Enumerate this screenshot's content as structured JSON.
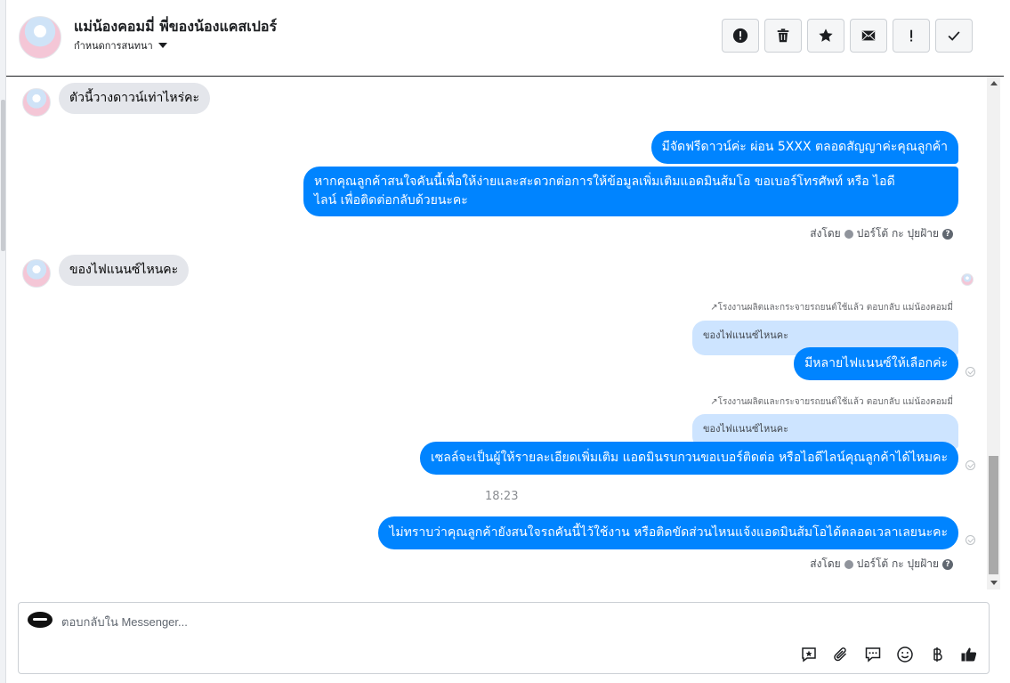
{
  "header": {
    "title": "แม่น้องคอมมี่ พี่ของน้องแคสเปอร์",
    "subtitle": "กำหนดการสนทนา",
    "actions": [
      {
        "name": "report-spam-button",
        "icon": "exclamation-circle-icon"
      },
      {
        "name": "delete-button",
        "icon": "trash-icon"
      },
      {
        "name": "star-button",
        "icon": "star-icon"
      },
      {
        "name": "mark-unread-button",
        "icon": "envelope-icon"
      },
      {
        "name": "flag-button",
        "icon": "exclamation-icon"
      },
      {
        "name": "mark-done-button",
        "icon": "checkmark-icon"
      }
    ]
  },
  "messages": {
    "in_1": "ตัวนี้วางดาวน์เท่าไหร่คะ",
    "out_1": "มีจัดฟรีดาวน์ค่ะ ผ่อน 5XXX ตลอดสัญญาค่ะคุณลูกค้า",
    "out_2_line1": "หากคุณลูกค้าสนใจคันนี้เพื่อให้ง่ายและสะดวกต่อการให้ข้อมูลเพิ่มเติมแอดมินส้มโอ ขอเบอร์โทรศัพท์ หรือ ไอดี",
    "out_2_line2": "ไลน์ เพื่อติดต่อกลับด้วยนะคะ",
    "sent_by_label": "ส่งโดย",
    "sent_by_name": "ปอร์โต้ กะ ปุยฝ้าย",
    "in_2": "ของไฟแนนซ์ไหนคะ",
    "reply_note": "โรงงานผลิตและกระจายรถยนต์ใช้แล้ว ตอบกลับ แม่น้องคอมมี่",
    "quoted": "ของไฟแนนซ์ไหนคะ",
    "out_3": "มีหลายไฟแนนซ์ให้เลือกค่ะ",
    "out_4": "เซลล์จะเป็นผู้ให้รายละเอียดเพิ่มเติม แอดมินรบกวนขอเบอร์ติดต่อ หรือไอดีไลน์คุณลูกค้าได้ไหมคะ",
    "time": "18:23",
    "out_5": "ไม่ทราบว่าคุณลูกค้ายังสนใจรถคันนี้ไว้ใช้งาน หรือติดขัดส่วนไหนแจ้งแอดมินส้มโอได้ตลอดเวลาเลยนะคะ"
  },
  "composer": {
    "placeholder": "ตอบกลับใน Messenger...",
    "tools": [
      "saved-reply-icon",
      "attachment-icon",
      "chat-bubble-icon",
      "emoji-icon",
      "baht-icon",
      "thumbs-up-icon"
    ]
  },
  "colors": {
    "outgoing": "#0084ff",
    "incoming": "#e4e6eb",
    "quote": "#cde4ff"
  }
}
